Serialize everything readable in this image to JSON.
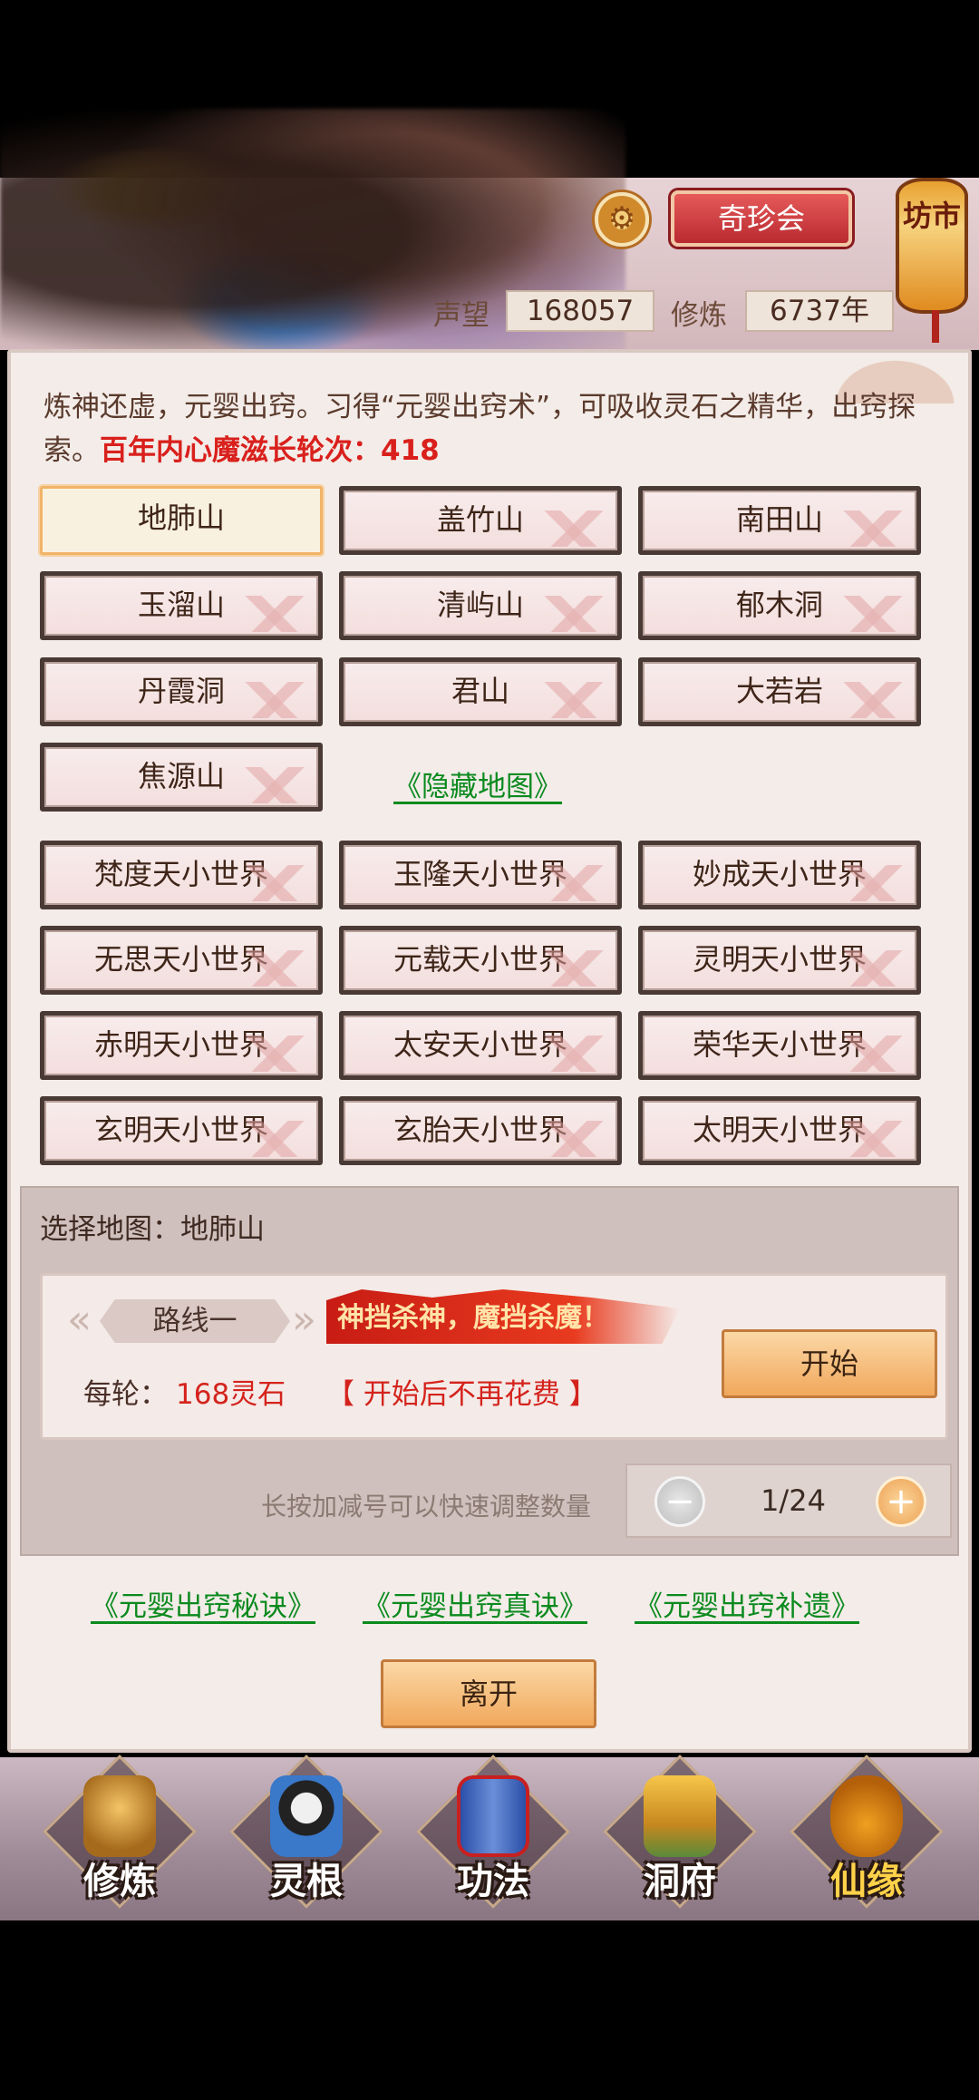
{
  "header": {
    "qizhen_label": "奇珍会",
    "fangshi_label": "坊市",
    "reputation_label": "声望",
    "reputation_value": "168057",
    "cultivation_label": "修炼",
    "cultivation_value": "6737年"
  },
  "intro": {
    "text": "炼神还虚，元婴出窍。习得“元婴出窍术”，可吸收灵石之精华，出窍探索。",
    "highlight": "百年内心魔滋长轮次：418"
  },
  "maps": {
    "mountains": [
      "地肺山",
      "盖竹山",
      "南田山",
      "玉溜山",
      "清屿山",
      "郁木洞",
      "丹霞洞",
      "君山",
      "大若岩",
      "焦源山"
    ],
    "hidden_map_link": "《隐藏地图》",
    "worlds": [
      "梵度天小世界",
      "玉隆天小世界",
      "妙成天小世界",
      "无思天小世界",
      "元载天小世界",
      "灵明天小世界",
      "赤明天小世界",
      "太安天小世界",
      "荣华天小世界",
      "玄明天小世界",
      "玄胎天小世界",
      "太明天小世界"
    ]
  },
  "selection": {
    "label": "选择地图：地肺山",
    "route_label": "路线一",
    "slogan": "神挡杀神，魔挡杀魔！",
    "cost_label": "每轮：",
    "cost_value": "168灵石",
    "cost_note": "【 开始后不再花费 】",
    "start_button": "开始",
    "hint": "长按加减号可以快速调整数量",
    "count": "1/24",
    "minus": "−",
    "plus": "+"
  },
  "links": [
    "《元婴出窍秘诀》",
    "《元婴出窍真诀》",
    "《元婴出窍补遗》"
  ],
  "leave_button": "离开",
  "nav": [
    "修炼",
    "灵根",
    "功法",
    "洞府",
    "仙缘"
  ],
  "colors": {
    "accent_red": "#d9201c",
    "link_green": "#0b8a1e",
    "button_orange": "#f1a85c"
  }
}
